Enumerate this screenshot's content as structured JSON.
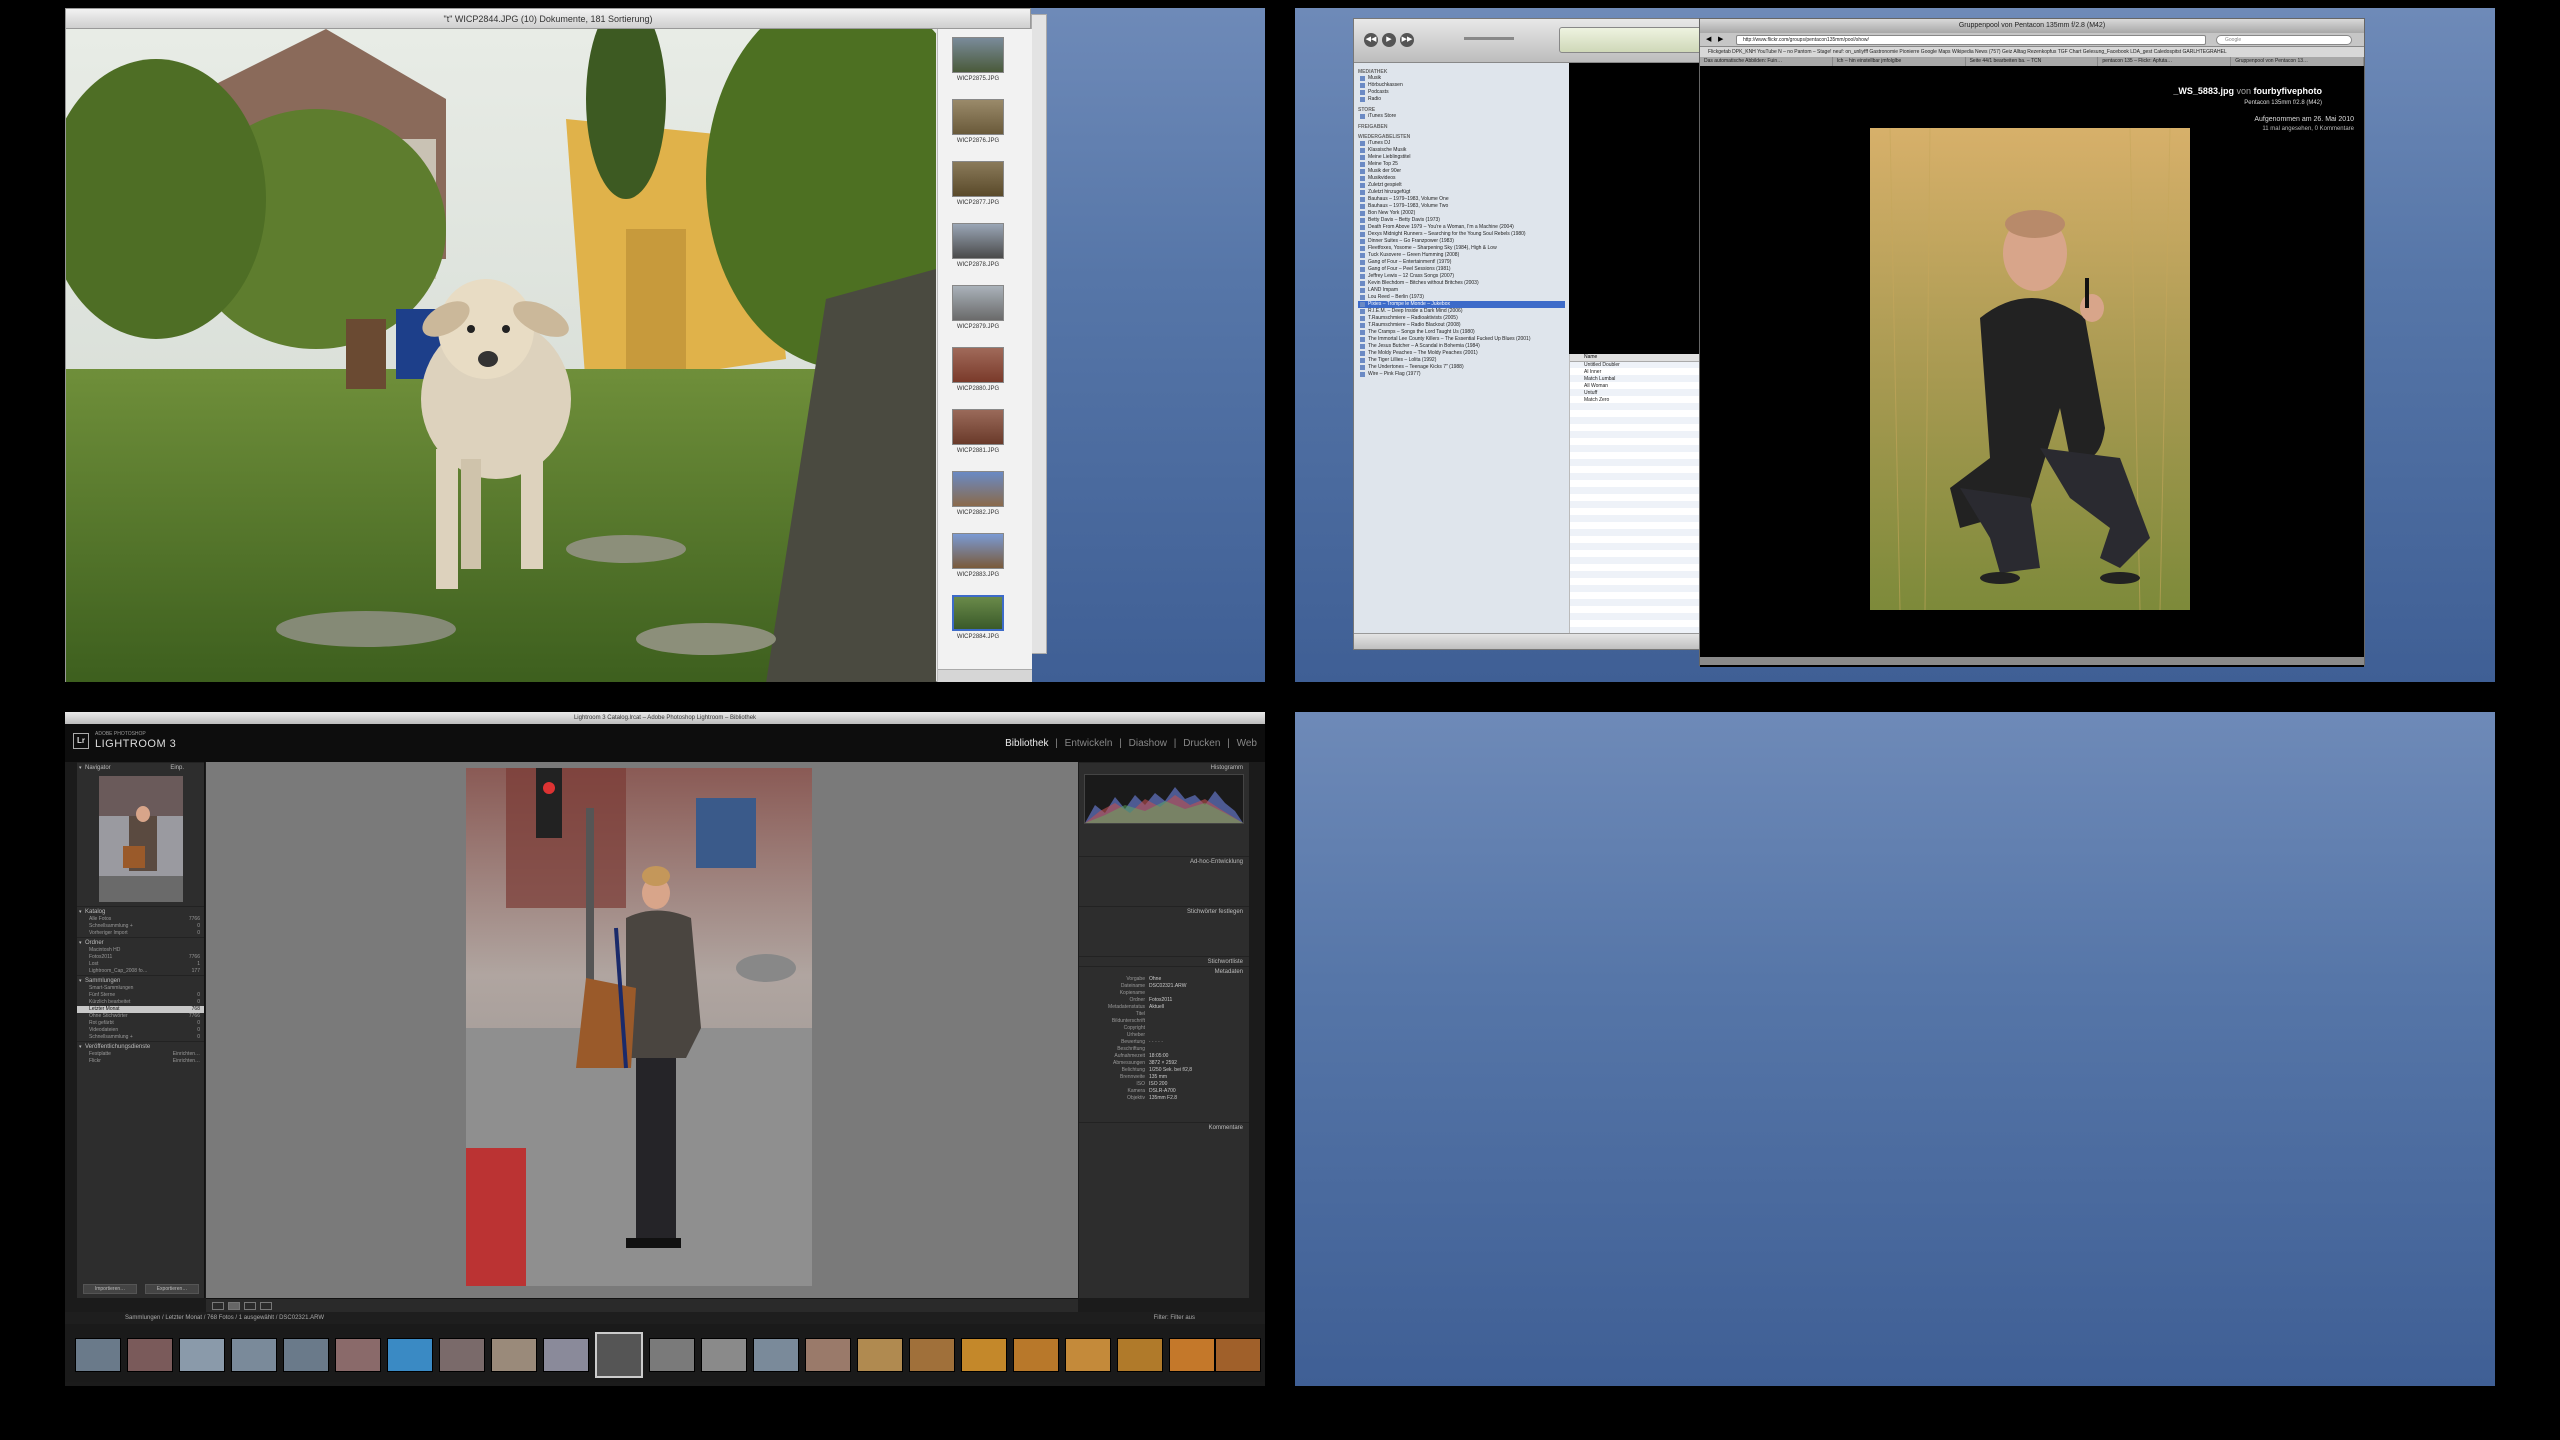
{
  "preview": {
    "title": "\"t\"  WICP2844.JPG (10) Dokumente, 181 Sortierung)",
    "thumbnails": [
      "WICP2875.JPG",
      "WICP2876.JPG",
      "WICP2877.JPG",
      "WICP2878.JPG",
      "WICP2879.JPG",
      "WICP2880.JPG",
      "WICP2881.JPG",
      "WICP2882.JPG",
      "WICP2883.JPG",
      "WICP2884.JPG"
    ]
  },
  "itunes": {
    "sections": {
      "mediathek": "MEDIATHEK",
      "store": "STORE",
      "freigaben": "FREIGABEN",
      "playlists": "WIEDERGABELISTEN"
    },
    "library_items": [
      "Musik",
      "Hörbuchkassen",
      "Podcasts",
      "Radio"
    ],
    "store_items": [
      "iTunes Store"
    ],
    "playlist_items": [
      "iTunes DJ",
      "Klassische Musik",
      "Meine Lieblingstitel",
      "Meine Top 25",
      "Musik der 90er",
      "Musikvideos",
      "Zuletzt gespielt",
      "Zuletzt hinzugefügt",
      "Bauhaus – 1979–1983, Volume One",
      "Bauhaus – 1979–1983, Volume Two",
      "Bon New York (2002)",
      "Betty Davis – Betty Davis (1973)",
      "Death From Above 1979 – You're a Woman, I'm a Machine (2004)",
      "Dexys Midnight Runners – Searching for the Young Soul Rebels (1980)",
      "Dinner Suites – Go Franzpower (1983)",
      "Fleetfoxes, Yosome – Sharpening Sky (1984), High & Low",
      "Tuck Kusovere – Green Humming (2008)",
      "Gang of Four – Entertainment! (1979)",
      "Gang of Four – Peel Sessions (1981)",
      "Jeffrey Lewis – 12 Crass Songs (2007)",
      "Kevin Blechdom – Bitches without Britches (2003)",
      "LAND Impam",
      "Lou Reed – Berlin (1973)",
      "Pixies – Trompe le Monde – Jukebox",
      "R.I.E.M. – Deep Inside a Dark Mind (2006)",
      "T.Raumschmiere – Radioaktivists (2005)",
      "T.Raumschmiere – Radio Blackout (2008)",
      "The Cramps – Songs the Lord Taught Us (1980)",
      "The Immortal Lee County Killers – The Essential Fucked Up Blues (2001)",
      "The Jesus Butcher – A Scandal in Bohemia (1984)",
      "The Moldy Peaches – The Moldy Peaches (2001)",
      "The Tiger Lillies – Lolita (1992)",
      "The Undertones – Teenage Kicks 7\" (1988)",
      "Wire – Pink Flag (1977)"
    ],
    "selected_playlist": "Pixies – Trompe le Monde – Jukebox",
    "list_header": "Name",
    "list_rows": [
      "Untitled Doubler",
      "Al Inner",
      "Match Lumbal",
      "All Woman",
      "Untuff",
      "Match Zero"
    ]
  },
  "safari": {
    "title": "Gruppenpool von Pentacon 135mm f/2.8 (M42)",
    "url": "http://www.flickr.com/groups/pentacon135mm/pool/show/",
    "search_placeholder": "Google",
    "bookmarks": "Flickgetab DPK_KNH    YouTube    N – no Pantom – Stage!     neuf: on_unliyfff     Gastronomie Pionierre     Google Maps     Wikipedia     News (757)     Geiz     Alltag     Rezenkopfus TGF Chart     Gelesung_Facebook     LDA_gest     Caledospitst     GARLHTEGRAHEL",
    "tabs": [
      "Das automatische Abbilden: Fuin…",
      "Ich – hin einstellbar jmfolglbe",
      "Seite 44/1 bearbeiten ba. – TCN",
      "pentacon 135 – Flickr: Apfuta…",
      "Gruppenpool von Pentacon 13…"
    ],
    "photo_title": "_WS_5883.jpg",
    "photo_by": "von",
    "photo_author": "fourbyfivephoto",
    "photo_group": "Pentacon 135mm f/2.8 (M42)",
    "photo_date": "Aufgenommen am 26. Mai 2010",
    "photo_stats": "11 mal angesehen, 0 Kommentare"
  },
  "lightroom": {
    "window_title": "Lightroom 3 Catalog.lrcat – Adobe Photoshop Lightroom – Bibliothek",
    "brand_small": "ADOBE PHOTOSHOP",
    "brand": "LIGHTROOM 3",
    "modules": [
      "Bibliothek",
      "Entwickeln",
      "Diashow",
      "Drucken",
      "Web"
    ],
    "module_sep": "|",
    "left_panels": {
      "navigator": "Navigator",
      "navigator_zoom": "Einp.",
      "catalog": "Katalog",
      "folders": "Ordner",
      "collections": "Sammlungen",
      "publish": "Veröffentlichungsdienste"
    },
    "catalog_rows": [
      {
        "label": "Alle Fotos",
        "count": "7766"
      },
      {
        "label": "Schnellsammlung +",
        "count": "0"
      },
      {
        "label": "Vorheriger Import",
        "count": "0"
      }
    ],
    "folder_rows": [
      {
        "label": "Macintosh HD",
        "count": ""
      },
      {
        "label": "Fotos2011",
        "count": "7766"
      },
      {
        "label": "Lost",
        "count": "1"
      },
      {
        "label": "Lightroom_Cap_2008 fo…",
        "count": "177"
      }
    ],
    "collection_rows": [
      {
        "label": "Smart-Sammlungen",
        "count": ""
      },
      {
        "label": "Fünf Sterne",
        "count": "0"
      },
      {
        "label": "Kürzlich bearbeitet",
        "count": "0"
      },
      {
        "label": "Letzter Monat",
        "count": "768"
      },
      {
        "label": "Ohne Stichwörter",
        "count": "7766"
      },
      {
        "label": "Rot gefärbt",
        "count": "0"
      },
      {
        "label": "Videodateien",
        "count": "0"
      },
      {
        "label": "Schnellsammlung +",
        "count": "0"
      }
    ],
    "publish_rows": [
      {
        "label": "Festplatte",
        "count": "Einrichten…"
      },
      {
        "label": "Flickr",
        "count": "Einrichten…"
      }
    ],
    "import_button": "Importieren…",
    "export_button": "Exportieren…",
    "right_panels": [
      "Histogramm",
      "Ad-hoc-Entwicklung",
      "Stichwörter festlegen",
      "Stichwortliste",
      "Metadaten",
      "Kommentare"
    ],
    "metadata_rows": [
      {
        "k": "Vorgabe",
        "v": "Ohne"
      },
      {
        "k": "Dateiname",
        "v": "DSC02321.ARW"
      },
      {
        "k": "Kopiename",
        "v": ""
      },
      {
        "k": "Ordner",
        "v": "Fotos2011"
      },
      {
        "k": "Metadatenstatus",
        "v": "Aktuell"
      },
      {
        "k": "Titel",
        "v": ""
      },
      {
        "k": "Bildunterschrift",
        "v": ""
      },
      {
        "k": "Copyright",
        "v": ""
      },
      {
        "k": "Urheber",
        "v": ""
      },
      {
        "k": "Bewertung",
        "v": "· · · · ·"
      },
      {
        "k": "Beschriftung",
        "v": ""
      },
      {
        "k": "Aufnahmezeit",
        "v": "18:05:00"
      },
      {
        "k": "Abmessungen",
        "v": "3872 × 2592"
      },
      {
        "k": "Belichtung",
        "v": "1/250 Sek. bei f/2,8"
      },
      {
        "k": "Brennweite",
        "v": "135 mm"
      },
      {
        "k": "ISO",
        "v": "ISO 200"
      },
      {
        "k": "Kamera",
        "v": "DSLR-A700"
      },
      {
        "k": "Objektiv",
        "v": "135mm F2.8"
      }
    ],
    "film_path": "Sammlungen / Letzter Monat / 768 Fotos / 1 ausgewählt / DSC02321.ARW",
    "filter_label": "Filter:",
    "filter_value": "Filter aus"
  }
}
